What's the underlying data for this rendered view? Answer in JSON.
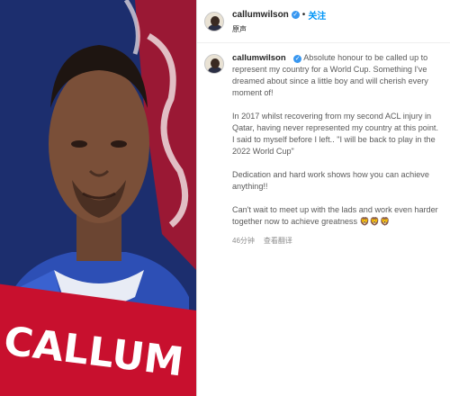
{
  "media": {
    "player_name_line1": "CALLUM WILSON"
  },
  "post": {
    "username": "callumwilson",
    "follow_label": "关注",
    "audio_label": "原声",
    "separator": "•"
  },
  "caption": {
    "username": "callumwilson",
    "para1": "Absolute honour to be called up to represent my country for a World Cup. Something I've dreamed about since a little boy and will cherish every moment of!",
    "para2": "In 2017 whilst recovering from my second ACL injury in Qatar, having never represented my country at this point. I said to myself before I left.. \"I will be back to play in the 2022 World Cup\"",
    "para3": "Dedication and hard work shows how you can achieve anything!!",
    "para4": "Can't wait to meet up with the lads and work even harder together now to achieve greatness",
    "emoji": "🦁🦁🦁"
  },
  "meta": {
    "time_ago": "46分钟",
    "translate_label": "查看翻译"
  },
  "colors": {
    "follow_blue": "#0095f6",
    "verified_blue": "#3897f0",
    "banner_red": "#c8102e",
    "kit_blue": "#1b2d6b"
  },
  "icons": {
    "verified": "verified-badge-icon"
  }
}
